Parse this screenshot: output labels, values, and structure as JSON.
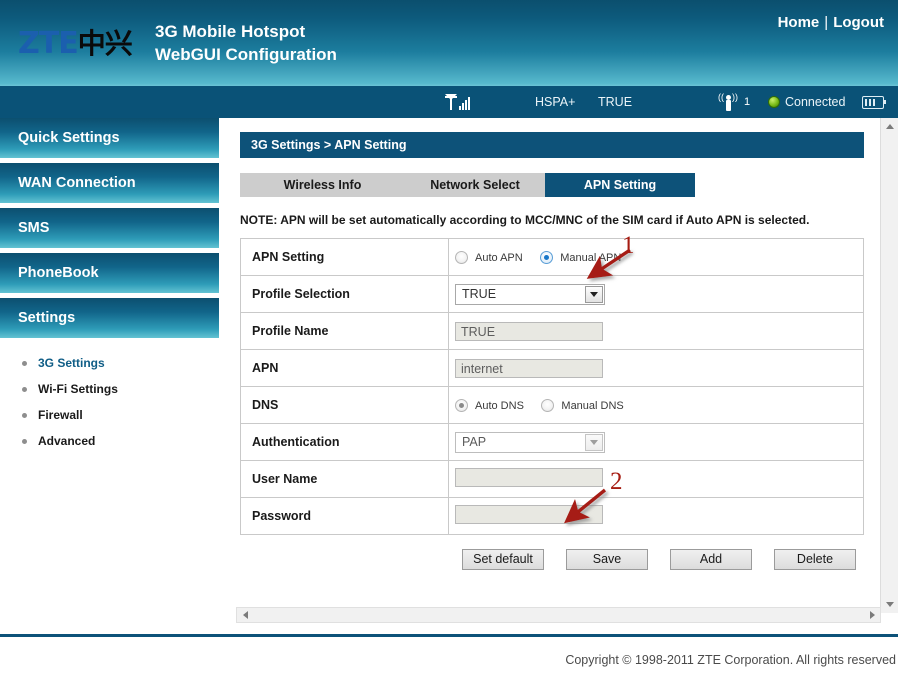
{
  "header": {
    "logo_zte": "ZTE",
    "logo_cn": "中兴",
    "title_line1": "3G Mobile Hotspot",
    "title_line2": "WebGUI Configuration",
    "home_label": "Home",
    "separator": "|",
    "logout_label": "Logout"
  },
  "statusbar": {
    "signal_icon": "signal-bars-icon",
    "network_type": "HSPA+",
    "operator": "TRUE",
    "wifi_icon": "wifi-antenna-icon",
    "wifi_clients": "1",
    "connection_status": "Connected",
    "battery_icon": "battery-icon"
  },
  "sidebar": {
    "nav": [
      {
        "label": "Quick Settings"
      },
      {
        "label": "WAN Connection"
      },
      {
        "label": "SMS"
      },
      {
        "label": "PhoneBook"
      },
      {
        "label": "Settings"
      }
    ],
    "subnav": [
      {
        "label": "3G Settings",
        "active": true
      },
      {
        "label": "Wi-Fi Settings",
        "active": false
      },
      {
        "label": "Firewall",
        "active": false
      },
      {
        "label": "Advanced",
        "active": false
      }
    ]
  },
  "main": {
    "breadcrumb": "3G Settings > APN Setting",
    "tabs": [
      {
        "label": "Wireless Info",
        "active": false
      },
      {
        "label": "Network Select",
        "active": false
      },
      {
        "label": "APN Setting",
        "active": true
      }
    ],
    "note": "NOTE: APN will be set automatically according to MCC/MNC of the SIM card if Auto APN is selected.",
    "rows": {
      "apn_setting": {
        "label": "APN Setting",
        "option_auto": "Auto APN",
        "option_manual": "Manual APN",
        "selected": "Manual APN"
      },
      "profile_selection": {
        "label": "Profile Selection",
        "value": "TRUE"
      },
      "profile_name": {
        "label": "Profile Name",
        "value": "TRUE"
      },
      "apn": {
        "label": "APN",
        "value": "internet"
      },
      "dns": {
        "label": "DNS",
        "option_auto": "Auto DNS",
        "option_manual": "Manual DNS",
        "selected": "Auto DNS"
      },
      "authentication": {
        "label": "Authentication",
        "value": "PAP"
      },
      "user_name": {
        "label": "User Name",
        "value": ""
      },
      "password": {
        "label": "Password",
        "value": ""
      }
    },
    "buttons": [
      {
        "label": "Set default"
      },
      {
        "label": "Save"
      },
      {
        "label": "Add"
      },
      {
        "label": "Delete"
      }
    ]
  },
  "annotations": [
    {
      "number": "1"
    },
    {
      "number": "2"
    }
  ],
  "footer": {
    "copyright": "Copyright © 1998-2011 ZTE Corporation. All rights reserved"
  },
  "colors": {
    "header_dark": "#0b4f6e",
    "header_light": "#6cc4d6",
    "accent_navy": "#0d5279",
    "statusbar_bg": "#0a5277",
    "tab_inactive": "#cdcdcd",
    "annotation_red": "#a61c12",
    "connected_green": "#79bb18",
    "link_blue": "#0f5d86"
  }
}
